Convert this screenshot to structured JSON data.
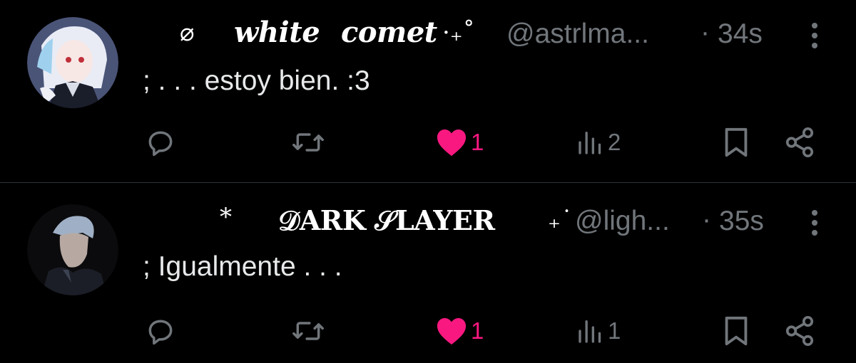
{
  "posts": [
    {
      "avatar_icon": "anime-girl-avatar",
      "name_prefix": "⌀",
      "name_word1": "white",
      "name_word2": "comet",
      "name_suffix": "·₊˚",
      "handle": "@astrlma...",
      "separator": "·",
      "time": "34s",
      "text": "; . . . estoy bien. :3",
      "actions": {
        "reply_icon": "reply-icon",
        "repost_icon": "repost-icon",
        "like_icon": "heart-filled-icon",
        "like_count": "1",
        "liked": true,
        "views_icon": "views-icon",
        "views_count": "2",
        "bookmark_icon": "bookmark-icon",
        "share_icon": "share-icon"
      }
    },
    {
      "avatar_icon": "man-avatar",
      "name_prefix": "*",
      "name_word1": "𝒟ARK 𝒮LAYER",
      "name_suffix": "₊˙",
      "handle": "@ligh...",
      "separator": "·",
      "time": "35s",
      "text": "; Igualmente . . .",
      "actions": {
        "reply_icon": "reply-icon",
        "repost_icon": "repost-icon",
        "like_icon": "heart-filled-icon",
        "like_count": "1",
        "liked": true,
        "views_icon": "views-icon",
        "views_count": "1",
        "bookmark_icon": "bookmark-icon",
        "share_icon": "share-icon"
      }
    }
  ],
  "colors": {
    "background": "#000000",
    "text": "#e7e9ea",
    "muted": "#71767b",
    "like": "#f91880",
    "divider": "#2f3336"
  }
}
